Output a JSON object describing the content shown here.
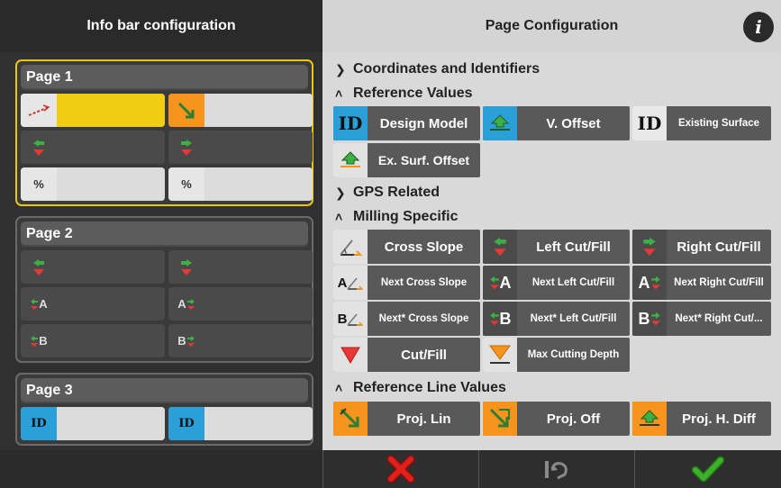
{
  "left": {
    "title": "Info bar configuration",
    "pages": [
      {
        "title": "Page 1",
        "slots": [
          {
            "icon": "cross-slope-red-icon",
            "text": ""
          },
          {
            "icon": "projection-arrow-icon",
            "text": ""
          },
          {
            "icon": "left-cut-fill-icon",
            "text": ""
          },
          {
            "icon": "right-cut-fill-icon",
            "text": ""
          },
          {
            "icon": "percent-icon",
            "text": "%"
          },
          {
            "icon": "percent-icon",
            "text": "%"
          }
        ]
      },
      {
        "title": "Page 2",
        "slots": [
          {
            "icon": "left-cut-fill-icon",
            "text": ""
          },
          {
            "icon": "right-cut-fill-icon",
            "text": ""
          },
          {
            "icon": "next-left-cut-fill-icon",
            "text": "A"
          },
          {
            "icon": "next-right-cut-fill-icon",
            "text": "A"
          },
          {
            "icon": "next-star-left-cut-fill-icon",
            "text": "B"
          },
          {
            "icon": "next-star-right-cut-fill-icon",
            "text": "B"
          }
        ]
      },
      {
        "title": "Page 3",
        "slots": [
          {
            "icon": "design-model-icon",
            "text": "ID"
          },
          {
            "icon": "design-model-icon",
            "text": "ID"
          }
        ]
      }
    ]
  },
  "right": {
    "title": "Page Configuration",
    "info_label": "i",
    "sections": {
      "coordinates": "Coordinates and Identifiers",
      "reference_values": "Reference Values",
      "gps": "GPS Related",
      "milling": "Milling Specific",
      "reference_line": "Reference Line Values"
    },
    "reference_values": {
      "design_model": {
        "icon": "ID",
        "label": "Design Model"
      },
      "v_offset": {
        "label": "V. Offset"
      },
      "existing_surface": {
        "icon": "ID",
        "label": "Existing Surface"
      },
      "ex_surf_offset": {
        "label": "Ex. Surf. Offset"
      }
    },
    "milling": {
      "cross_slope": "Cross Slope",
      "left_cut_fill": "Left Cut/Fill",
      "right_cut_fill": "Right Cut/Fill",
      "next_cross_slope": "Next Cross Slope",
      "next_left_cut_fill": "Next Left Cut/Fill",
      "next_right_cut_fill": "Next Right Cut/Fill",
      "next_star_cross_slope": "Next* Cross Slope",
      "next_star_left_cut_fill": "Next* Left Cut/Fill",
      "next_star_right_cut_fill": "Next* Right Cut/...",
      "cut_fill": "Cut/Fill",
      "max_cutting_depth": "Max Cutting Depth",
      "letter_a": "A",
      "letter_b": "B"
    },
    "reference_line": {
      "proj_lin": "Proj. Lin",
      "proj_off": "Proj. Off",
      "proj_h_diff": "Proj. H. Diff"
    }
  },
  "colors": {
    "selected_border": "#e8c612",
    "slot_yellow": "#f0cc13",
    "accent_orange": "#f7941d",
    "accent_blue": "#2ba0d8",
    "cancel_red": "#e0201b",
    "ok_green": "#3fae2a"
  }
}
